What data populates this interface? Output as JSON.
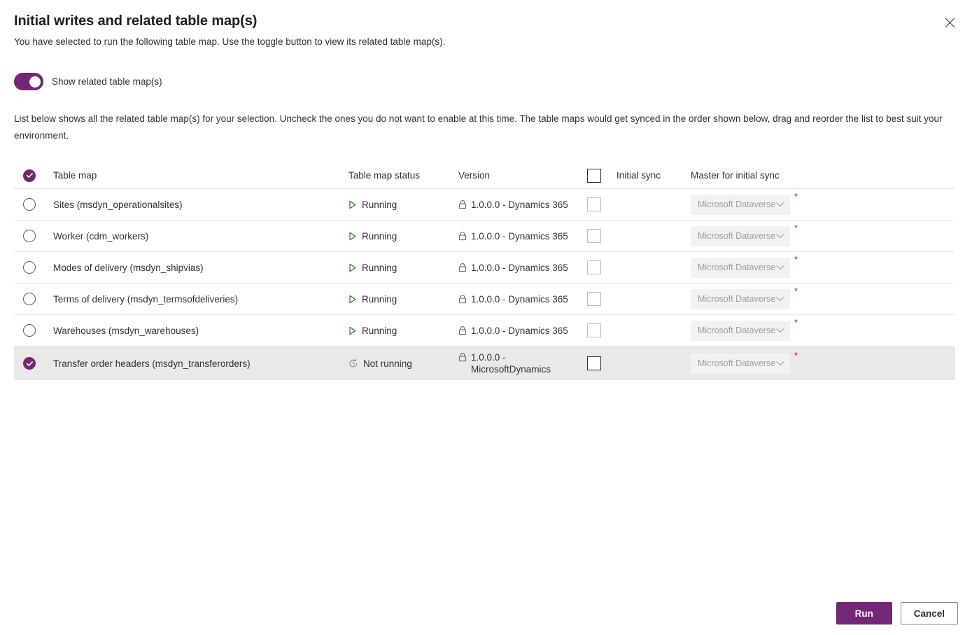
{
  "dialog": {
    "title": "Initial writes and related table map(s)",
    "subtitle": "You have selected to run the following table map. Use the toggle button to view its related table map(s).",
    "close_label": "Close"
  },
  "toggle": {
    "label": "Show related table map(s)",
    "state": "on",
    "accent_color": "#742774"
  },
  "description": "List below shows all the related table map(s) for your selection. Uncheck the ones you do not want to enable at this time. The table maps would get synced in the order shown below, drag and reorder the list to best suit your environment.",
  "table": {
    "headers": {
      "select_all": "checked",
      "table_map": "Table map",
      "table_map_status": "Table map status",
      "version": "Version",
      "initial_sync": "Initial sync",
      "master_for_initial_sync": "Master for initial sync"
    },
    "rows": [
      {
        "selected": false,
        "name": "Sites (msdyn_operationalsites)",
        "status": "Running",
        "status_icon": "play-icon",
        "version": "1.0.0.0 - Dynamics 365",
        "initial_sync_checked": false,
        "initial_sync_enabled": false,
        "master": "Microsoft Dataverse",
        "master_required": "*",
        "master_enabled": false,
        "highlighted": false
      },
      {
        "selected": false,
        "name": "Worker (cdm_workers)",
        "status": "Running",
        "status_icon": "play-icon",
        "version": "1.0.0.0 - Dynamics 365",
        "initial_sync_checked": false,
        "initial_sync_enabled": false,
        "master": "Microsoft Dataverse",
        "master_required": "*",
        "master_enabled": false,
        "highlighted": false
      },
      {
        "selected": false,
        "name": "Modes of delivery (msdyn_shipvias)",
        "status": "Running",
        "status_icon": "play-icon",
        "version": "1.0.0.0 - Dynamics 365",
        "initial_sync_checked": false,
        "initial_sync_enabled": false,
        "master": "Microsoft Dataverse",
        "master_required": "*",
        "master_enabled": false,
        "highlighted": false
      },
      {
        "selected": false,
        "name": "Terms of delivery (msdyn_termsofdeliveries)",
        "status": "Running",
        "status_icon": "play-icon",
        "version": "1.0.0.0 - Dynamics 365",
        "initial_sync_checked": false,
        "initial_sync_enabled": false,
        "master": "Microsoft Dataverse",
        "master_required": "*",
        "master_enabled": false,
        "highlighted": false
      },
      {
        "selected": false,
        "name": "Warehouses (msdyn_warehouses)",
        "status": "Running",
        "status_icon": "play-icon",
        "version": "1.0.0.0 - Dynamics 365",
        "initial_sync_checked": false,
        "initial_sync_enabled": false,
        "master": "Microsoft Dataverse",
        "master_required": "*",
        "master_enabled": false,
        "highlighted": false
      },
      {
        "selected": true,
        "name": "Transfer order headers (msdyn_transferorders)",
        "status": "Not running",
        "status_icon": "refresh-clock-icon",
        "version": "1.0.0.0 - MicrosoftDynamics",
        "initial_sync_checked": false,
        "initial_sync_enabled": true,
        "master": "Microsoft Dataverse",
        "master_required": "*",
        "master_enabled": false,
        "highlighted": true
      }
    ]
  },
  "footer": {
    "run_label": "Run",
    "cancel_label": "Cancel"
  }
}
